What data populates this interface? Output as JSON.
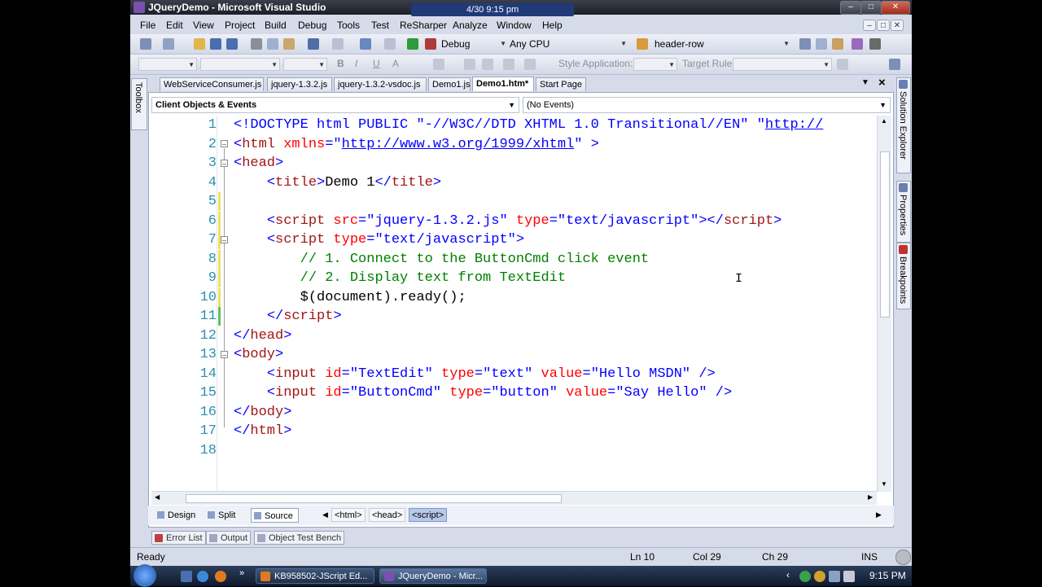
{
  "window": {
    "title": "JQueryDemo - Microsoft Visual Studio",
    "clock_overlay": "4/30  9:15 pm"
  },
  "menu": [
    "File",
    "Edit",
    "View",
    "Project",
    "Build",
    "Debug",
    "Tools",
    "Test",
    "ReSharper",
    "Analyze",
    "Window",
    "Help"
  ],
  "toolbar1": {
    "config": "Debug",
    "platform": "Any CPU",
    "find_combo": "header-row"
  },
  "toolbar2": {
    "style_app_label": "Style Application:",
    "target_rule_label": "Target Rule:",
    "bold": "B",
    "italic": "I",
    "underline": "U",
    "fontcolor": "A"
  },
  "tabs": [
    "WebServiceConsumer.js",
    "jquery-1.3.2.js",
    "jquery-1.3.2-vsdoc.js",
    "Demo1.js",
    "Demo1.htm*",
    "Start Page"
  ],
  "side_tabs": {
    "toolbox": "Toolbox",
    "solution_explorer": "Solution Explorer",
    "properties": "Properties",
    "breakpoints": "Breakpoints"
  },
  "navbar": {
    "objects": "Client Objects & Events",
    "events": "(No Events)"
  },
  "line_numbers": [
    "1",
    "2",
    "3",
    "4",
    "5",
    "6",
    "7",
    "8",
    "9",
    "10",
    "11",
    "12",
    "13",
    "14",
    "15",
    "16",
    "17",
    "18"
  ],
  "code": {
    "l1_doctype": "<!DOCTYPE html PUBLIC ",
    "l1_pub": "\"-//W3C//DTD XHTML 1.0 Transitional//EN\" ",
    "l1_q": "\"",
    "l1_url": "http://",
    "l2_open": "<",
    "l2_tag": "html",
    "l2_attr": " xmlns",
    "l2_eq": "=\"",
    "l2_url": "http://www.w3.org/1999/xhtml",
    "l2_close": "\" >",
    "l3_open": "<",
    "l3_tag": "head",
    "l3_close": ">",
    "l4_open": "<",
    "l4_tag": "title",
    "l4_gt": ">",
    "l4_text": "Demo 1",
    "l4_endlt": "</",
    "l4_endtag": "title",
    "l4_endgt": ">",
    "l6_lt": "<",
    "l6_tag": "script",
    "l6_attr1": " src",
    "l6_val1": "=\"jquery-1.3.2.js\"",
    "l6_attr2": " type",
    "l6_val2": "=\"text/javascript\"",
    "l6_gt": "></",
    "l6_endtag": "script",
    "l6_endgt": ">",
    "l7_lt": "<",
    "l7_tag": "script",
    "l7_attr": " type",
    "l7_val": "=\"text/javascript\"",
    "l7_gt": ">",
    "l8_comment": "// 1. Connect to the ButtonCmd click event",
    "l9_comment": "// 2. Display text from TextEdit",
    "l10_code": "$(document).ready();",
    "l11_lt": "</",
    "l11_tag": "script",
    "l11_gt": ">",
    "l12_lt": "</",
    "l12_tag": "head",
    "l12_gt": ">",
    "l13_lt": "<",
    "l13_tag": "body",
    "l13_gt": ">",
    "l14_lt": "<",
    "l14_tag": "input",
    "l14_attr1": " id",
    "l14_val1": "=\"TextEdit\"",
    "l14_attr2": " type",
    "l14_val2": "=\"text\"",
    "l14_attr3": " value",
    "l14_val3": "=\"Hello MSDN\"",
    "l14_end": " />",
    "l15_lt": "<",
    "l15_tag": "input",
    "l15_attr1": " id",
    "l15_val1": "=\"ButtonCmd\"",
    "l15_attr2": " type",
    "l15_val2": "=\"button\"",
    "l15_attr3": " value",
    "l15_val3": "=\"Say Hello\"",
    "l15_end": " />",
    "l16_lt": "</",
    "l16_tag": "body",
    "l16_gt": ">",
    "l17_lt": "</",
    "l17_tag": "html",
    "l17_gt": ">"
  },
  "viewbar": {
    "design": "Design",
    "split": "Split",
    "source": "Source",
    "crumbs": [
      "<html>",
      "<head>",
      "<script>"
    ]
  },
  "bottom_tabs": [
    "Error List",
    "Output",
    "Object Test Bench"
  ],
  "status": {
    "ready": "Ready",
    "ln": "Ln 10",
    "col": "Col 29",
    "ch": "Ch 29",
    "ins": "INS"
  },
  "taskbar": {
    "item1": "KB958502-JScript Ed...",
    "item2": "JQueryDemo - Micr...",
    "time": "9:15 PM"
  },
  "colors": {
    "tag": "#a31515",
    "attr": "#ff0000",
    "value": "#0000ff",
    "comment": "#008000",
    "line_number": "#2b91af"
  }
}
